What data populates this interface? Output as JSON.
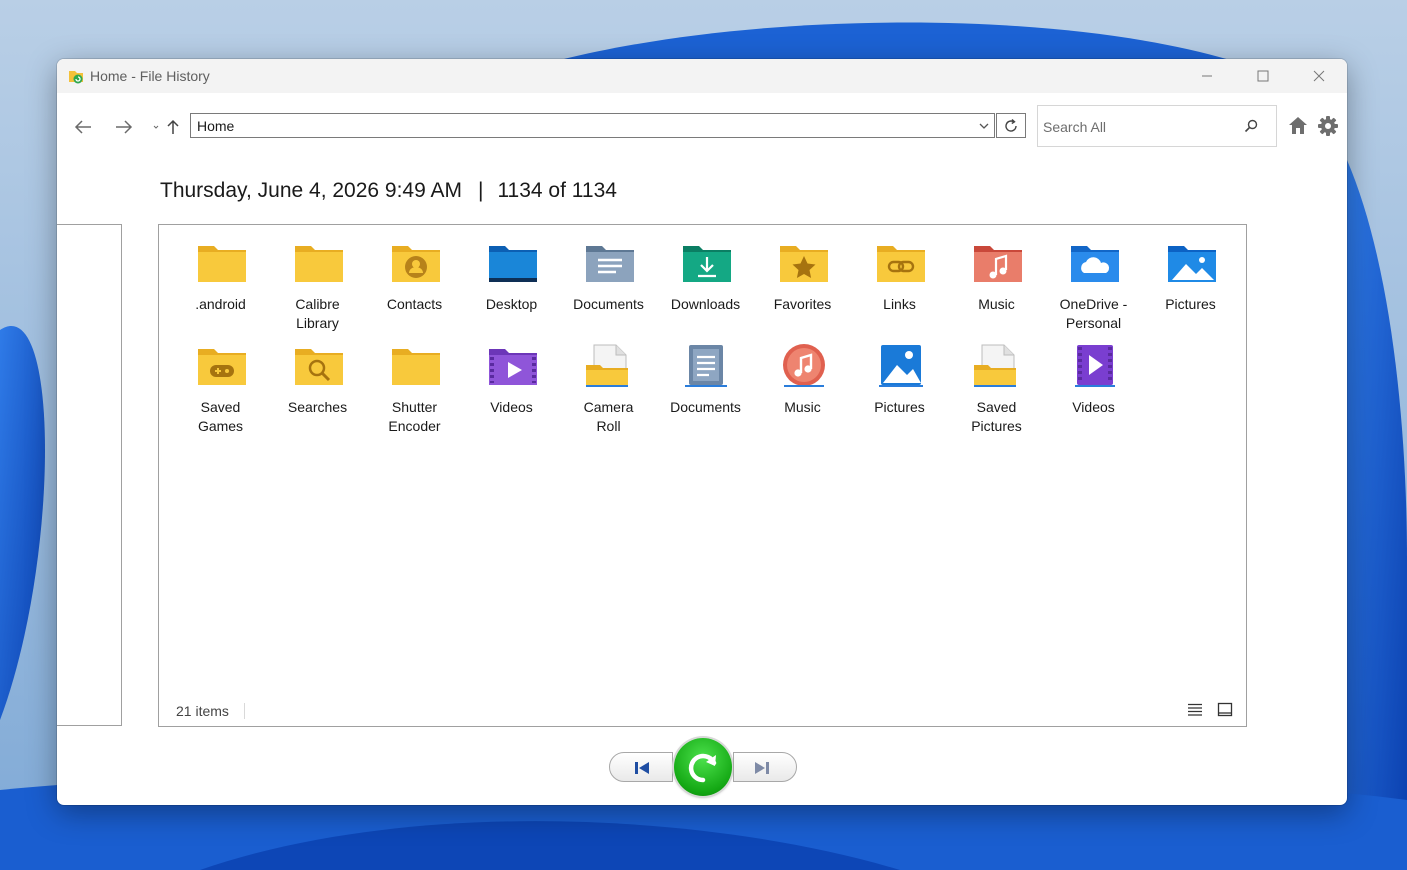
{
  "window": {
    "title": "Home - File History"
  },
  "toolbar": {
    "address": "Home",
    "search_placeholder": "Search All"
  },
  "header": {
    "date": "Thursday, June 4, 2026 9:49 AM",
    "separator": "|",
    "position": "1134 of 1134"
  },
  "items": [
    {
      "line1": ".android",
      "line2": "",
      "icon": "folder-icon"
    },
    {
      "line1": "Calibre",
      "line2": "Library",
      "icon": "folder-icon"
    },
    {
      "line1": "Contacts",
      "line2": "",
      "icon": "contacts-folder-icon"
    },
    {
      "line1": "Desktop",
      "line2": "",
      "icon": "desktop-folder-icon"
    },
    {
      "line1": "Documents",
      "line2": "",
      "icon": "documents-folder-icon"
    },
    {
      "line1": "Downloads",
      "line2": "",
      "icon": "downloads-folder-icon"
    },
    {
      "line1": "Favorites",
      "line2": "",
      "icon": "favorites-folder-icon"
    },
    {
      "line1": "Links",
      "line2": "",
      "icon": "links-folder-icon"
    },
    {
      "line1": "Music",
      "line2": "",
      "icon": "music-folder-icon"
    },
    {
      "line1": "OneDrive -",
      "line2": "Personal",
      "icon": "onedrive-folder-icon"
    },
    {
      "line1": "Pictures",
      "line2": "",
      "icon": "pictures-folder-icon"
    },
    {
      "line1": "Saved",
      "line2": "Games",
      "icon": "saved-games-folder-icon"
    },
    {
      "line1": "Searches",
      "line2": "",
      "icon": "searches-folder-icon"
    },
    {
      "line1": "Shutter",
      "line2": "Encoder",
      "icon": "folder-icon"
    },
    {
      "line1": "Videos",
      "line2": "",
      "icon": "videos-folder-icon"
    },
    {
      "line1": "Camera",
      "line2": "Roll",
      "icon": "camera-roll-library-icon"
    },
    {
      "line1": "Documents",
      "line2": "",
      "icon": "documents-library-icon"
    },
    {
      "line1": "Music",
      "line2": "",
      "icon": "music-library-icon"
    },
    {
      "line1": "Pictures",
      "line2": "",
      "icon": "pictures-library-icon"
    },
    {
      "line1": "Saved",
      "line2": "Pictures",
      "icon": "saved-pictures-library-icon"
    },
    {
      "line1": "Videos",
      "line2": "",
      "icon": "videos-library-icon"
    }
  ],
  "status": {
    "item_count": "21 items"
  },
  "colors": {
    "folder_yellow": "#f8c93c",
    "restore_green": "#18b018",
    "wallpaper_blue": "#1f66d6"
  }
}
